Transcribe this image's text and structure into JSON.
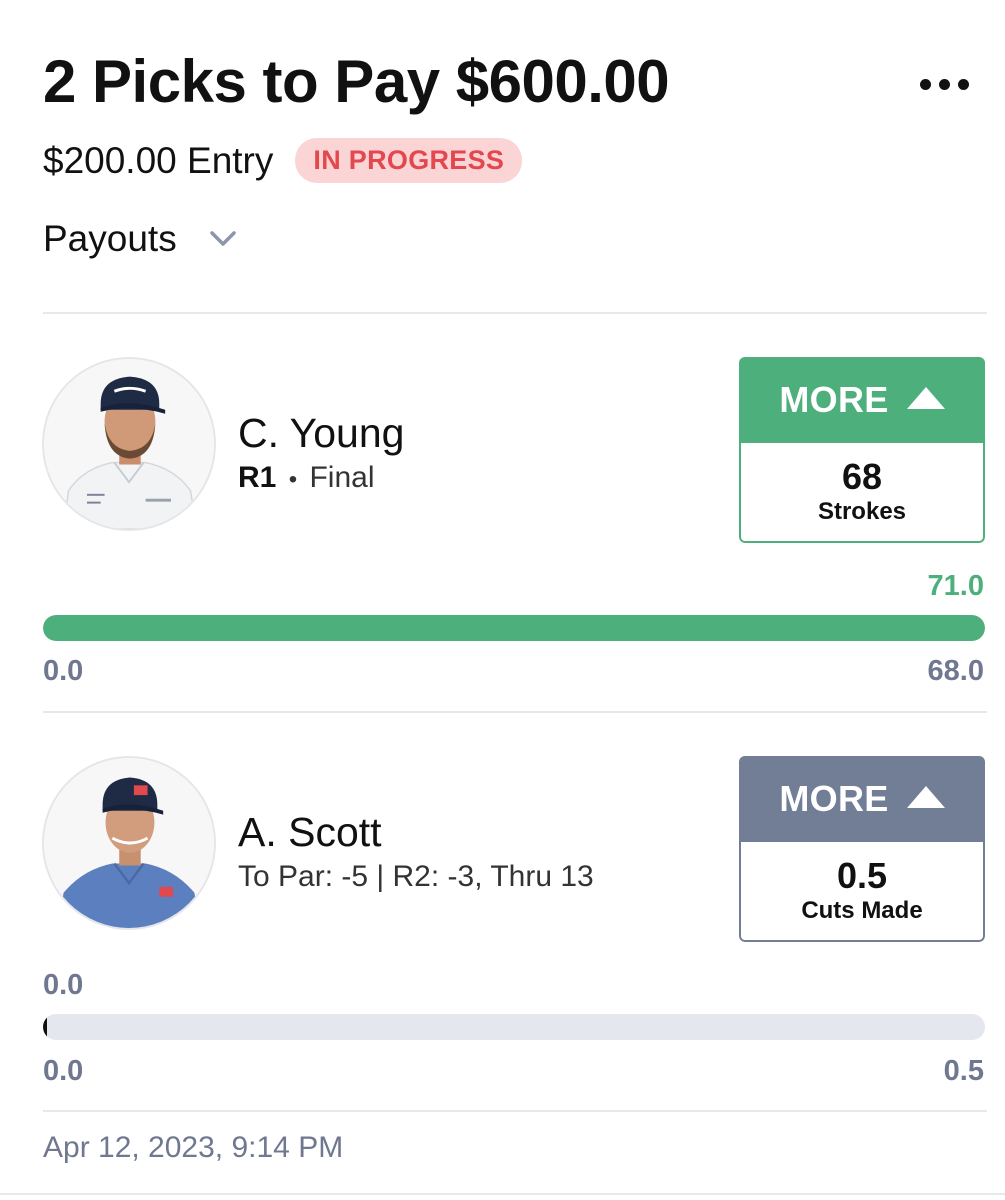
{
  "header": {
    "title": "2 Picks to Pay $600.00",
    "entry": "$200.00 Entry",
    "status_badge": "IN PROGRESS",
    "payouts_label": "Payouts",
    "more_icon": "ellipsis-icon",
    "payouts_icon": "chevron-down-icon"
  },
  "colors": {
    "accent_green": "#4daf7c",
    "neutral_slate": "#717e96",
    "badge_bg": "#fbd5d5",
    "badge_text": "#e2484d"
  },
  "picks": [
    {
      "name": "C. Young",
      "round_label": "R1",
      "separator": "•",
      "status": "Final",
      "choice": "MORE",
      "choice_icon": "triangle-up-icon",
      "line_value": "68",
      "stat": "Strokes",
      "progress_current": "71.0",
      "progress_min": "0.0",
      "progress_max": "68.0",
      "progress_fraction": 1.0
    },
    {
      "name": "A. Scott",
      "status": "To Par: -5 | R2: -3, Thru 13",
      "choice": "MORE",
      "choice_icon": "triangle-up-icon",
      "line_value": "0.5",
      "stat": "Cuts Made",
      "progress_current": "0.0",
      "progress_min": "0.0",
      "progress_max": "0.5",
      "progress_fraction": 0.0
    }
  ],
  "footer": {
    "timestamp": "Apr 12, 2023, 9:14 PM"
  }
}
